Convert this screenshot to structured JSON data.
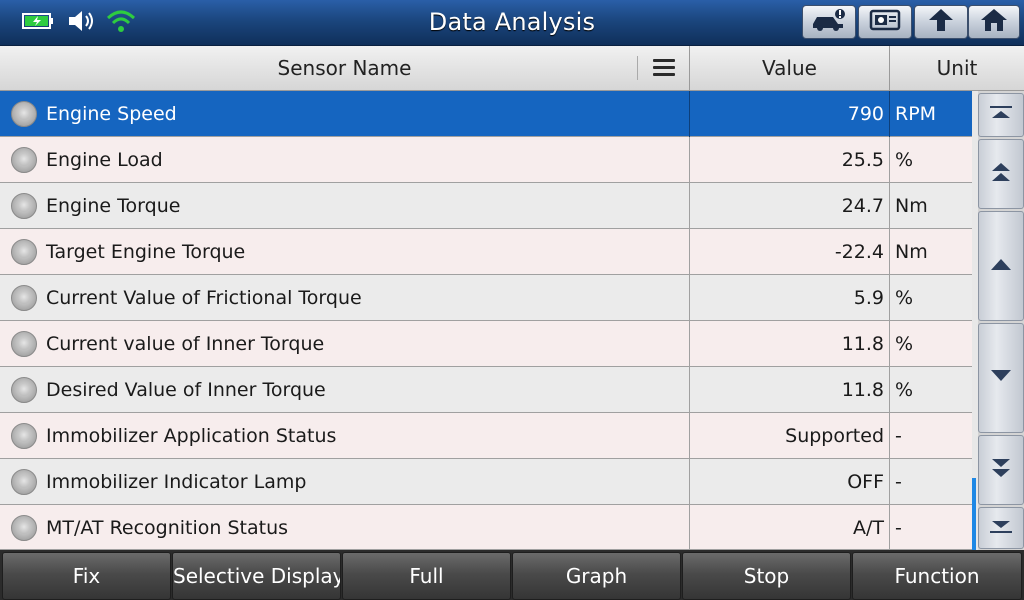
{
  "header": {
    "title": "Data Analysis",
    "status_icons": [
      "battery-charging-icon",
      "speaker-icon",
      "wifi-icon"
    ],
    "buttons": [
      "vehicle-info-icon",
      "screenshot-icon",
      "back-icon",
      "home-icon"
    ]
  },
  "columns": {
    "sensor_name": "Sensor Name",
    "value": "Value",
    "unit": "Unit"
  },
  "rows": [
    {
      "name": "Engine Speed",
      "value": "790",
      "unit": "RPM",
      "selected": true
    },
    {
      "name": "Engine Load",
      "value": "25.5",
      "unit": "%"
    },
    {
      "name": "Engine Torque",
      "value": "24.7",
      "unit": "Nm"
    },
    {
      "name": "Target Engine Torque",
      "value": "-22.4",
      "unit": "Nm"
    },
    {
      "name": "Current Value of Frictional Torque",
      "value": "5.9",
      "unit": "%"
    },
    {
      "name": "Current value of Inner Torque",
      "value": "11.8",
      "unit": "%"
    },
    {
      "name": "Desired Value of Inner Torque",
      "value": "11.8",
      "unit": "%"
    },
    {
      "name": "Immobilizer Application Status",
      "value": "Supported",
      "unit": "-"
    },
    {
      "name": "Immobilizer Indicator Lamp",
      "value": "OFF",
      "unit": "-"
    },
    {
      "name": "MT/AT Recognition Status",
      "value": "A/T",
      "unit": "-"
    }
  ],
  "footer": {
    "buttons": [
      "Fix",
      "Selective Display",
      "Full",
      "Graph",
      "Stop",
      "Function"
    ]
  },
  "colors": {
    "title_bar": "#1b467e",
    "selected_row": "#1565c0",
    "scroll_thumb": "#1e88e5"
  }
}
